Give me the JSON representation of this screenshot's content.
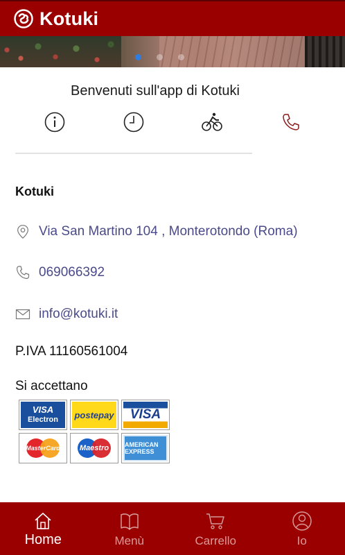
{
  "app": {
    "title": "Kotuki"
  },
  "banner": {
    "slides": 3,
    "active_slide": 1
  },
  "welcome": {
    "text": "Benvenuti sull'app di Kotuki"
  },
  "quick_actions": [
    {
      "icon": "info-icon"
    },
    {
      "icon": "clock-icon"
    },
    {
      "icon": "bicycle-delivery-icon"
    },
    {
      "icon": "phone-icon"
    }
  ],
  "business": {
    "name": "Kotuki",
    "address": "Via San Martino 104 , Monterotondo (Roma)",
    "phone": "069066392",
    "email": "info@kotuki.it",
    "vat": "P.IVA 11160561004"
  },
  "payments": {
    "title": "Si accettano",
    "cards": [
      {
        "label": "VISA",
        "sub": "Electron"
      },
      {
        "label": "postepay"
      },
      {
        "label": "VISA"
      },
      {
        "label": "MasterCard"
      },
      {
        "label": "Maestro"
      },
      {
        "label": "AMERICAN EXPRESS"
      }
    ]
  },
  "bottom_nav": {
    "active": "Home",
    "items": [
      {
        "label": "Home",
        "icon": "home-icon"
      },
      {
        "label": "Menù",
        "icon": "book-icon"
      },
      {
        "label": "Carrello",
        "icon": "cart-icon"
      },
      {
        "label": "Io",
        "icon": "user-icon"
      }
    ]
  },
  "colors": {
    "brand": "#9b0000",
    "link": "#4a4a8a",
    "slider_active": "#2f7de1"
  }
}
